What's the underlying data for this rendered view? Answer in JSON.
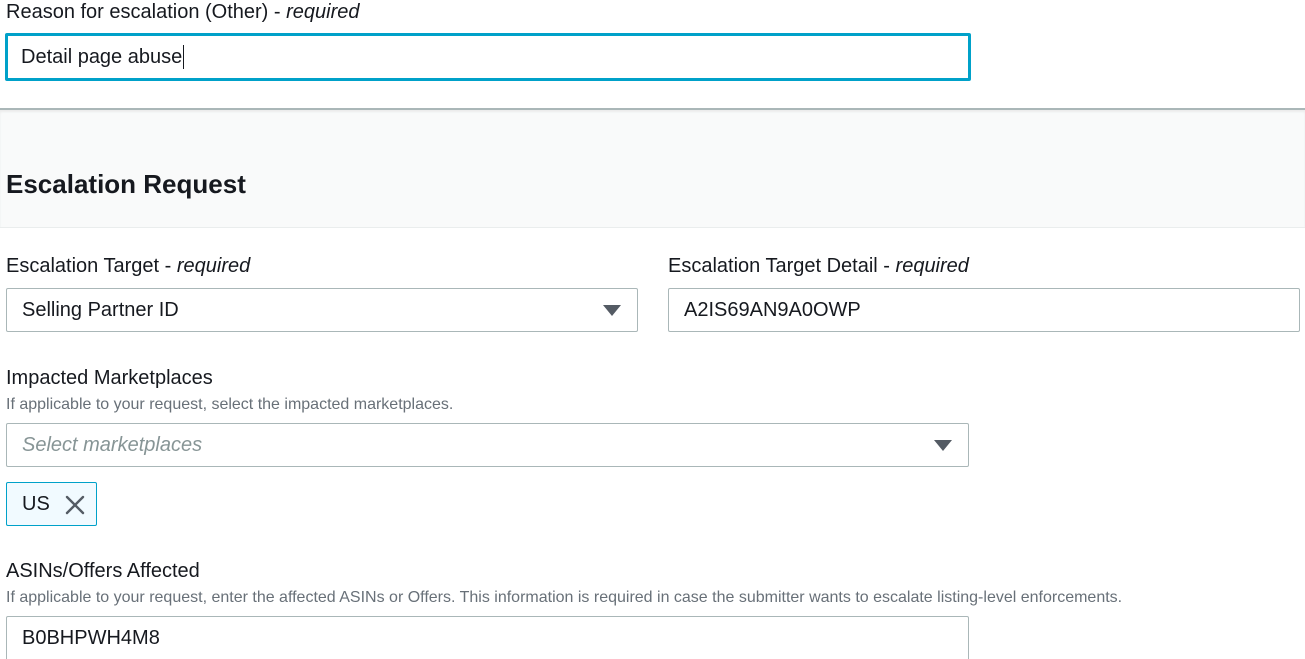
{
  "reason": {
    "label": "Reason for escalation (Other)",
    "required_marker": "required",
    "value": "Detail page abuse"
  },
  "section": {
    "title": "Escalation Request"
  },
  "escalation_target": {
    "label": "Escalation Target",
    "required_marker": "required",
    "selected": "Selling Partner ID"
  },
  "escalation_target_detail": {
    "label": "Escalation Target Detail",
    "required_marker": "required",
    "value": "A2IS69AN9A0OWP"
  },
  "marketplaces": {
    "label": "Impacted Marketplaces",
    "description": "If applicable to your request, select the impacted marketplaces.",
    "placeholder": "Select marketplaces",
    "tokens": [
      {
        "label": "US"
      }
    ]
  },
  "asins": {
    "label": "ASINs/Offers Affected",
    "description": "If applicable to your request, enter the affected ASINs or Offers. This information is required in case the submitter wants to escalate listing-level enforcements.",
    "value": "B0BHPWH4M8"
  },
  "icons": {
    "dropdown": "caret-down-icon",
    "dismiss": "close-icon"
  },
  "colors": {
    "focus": "#00a1c9",
    "border": "#aab7b8",
    "token_bg": "#f1faff",
    "hint_text": "#687078"
  }
}
